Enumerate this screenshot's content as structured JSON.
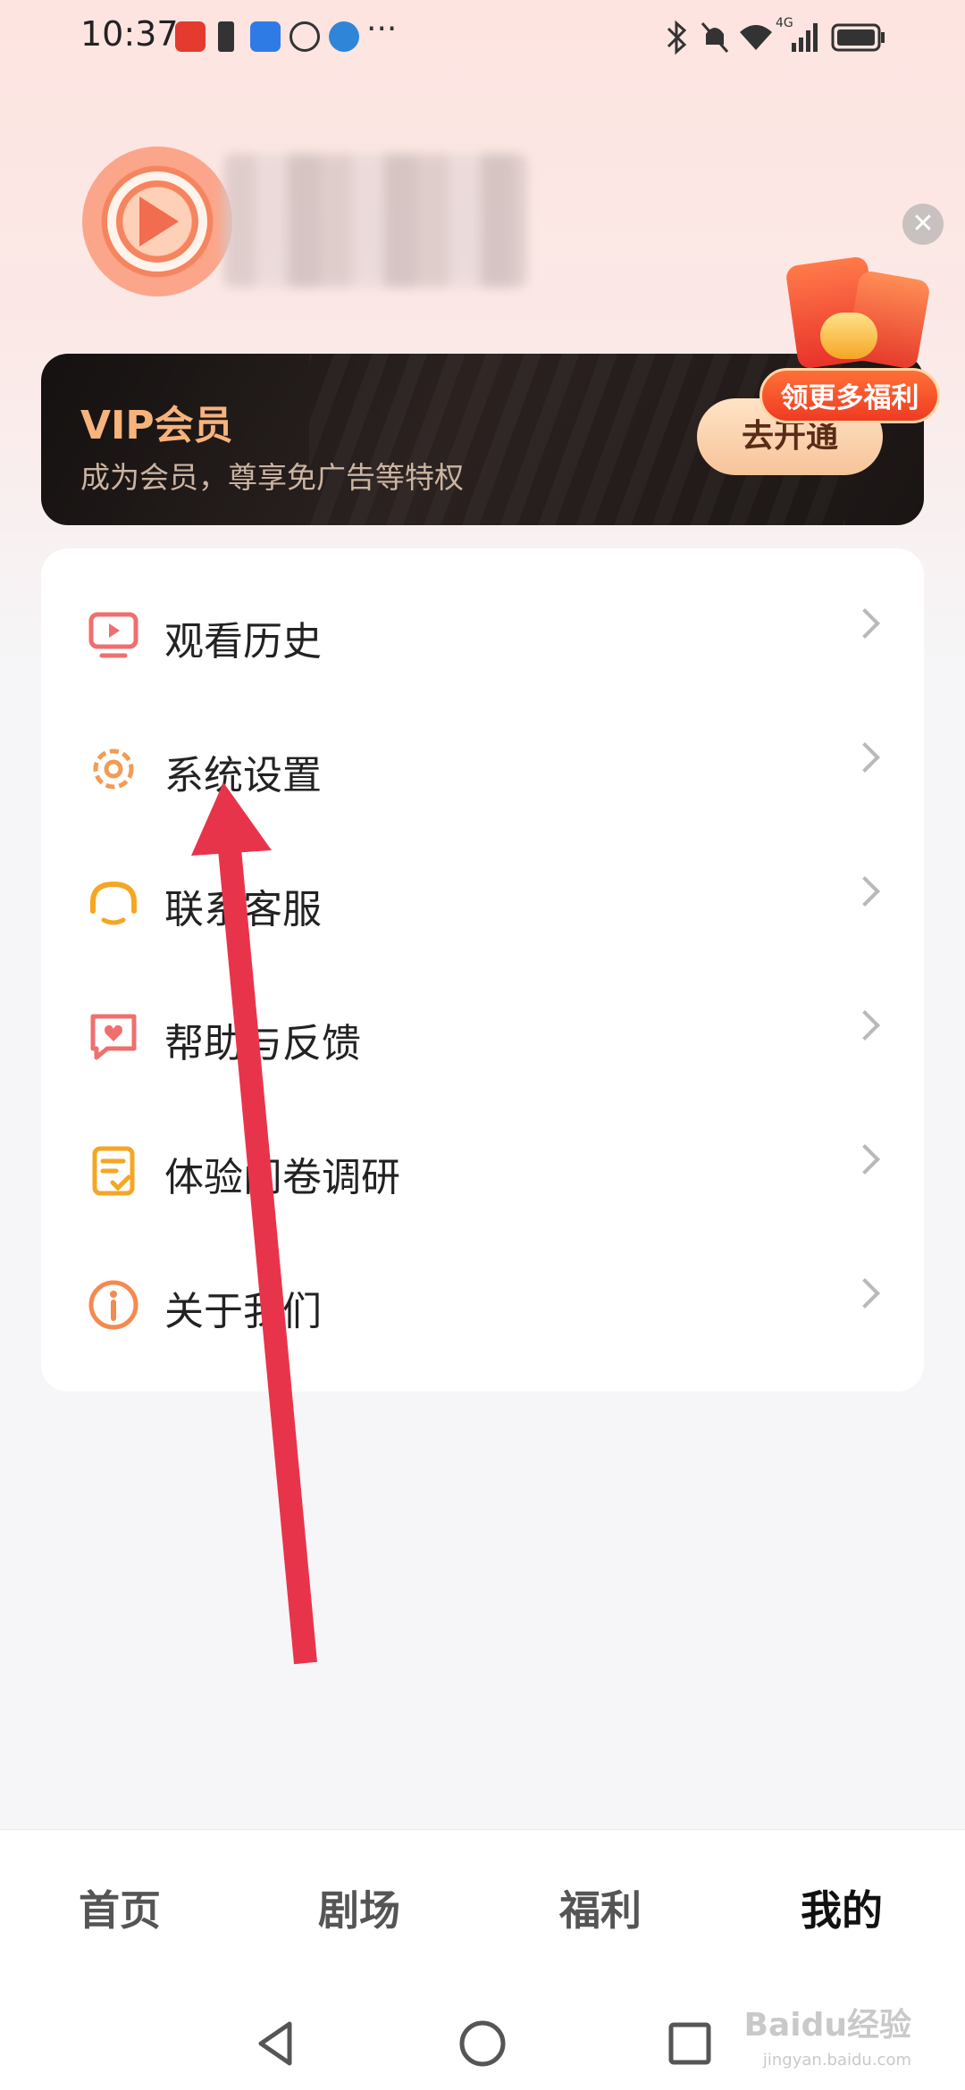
{
  "status_bar": {
    "time": "10:37",
    "left_icons": [
      "taobao-icon",
      "battery-alert-icon",
      "contacts-icon",
      "hand-icon",
      "browser-icon",
      "more-dots-icon"
    ],
    "right_icons": [
      "bluetooth-icon",
      "mute-bell-icon",
      "wifi-icon",
      "cellular-4g-icon",
      "battery-icon"
    ],
    "network_label": "4G",
    "more_label": "···"
  },
  "profile": {
    "avatar_icon": "play-logo-avatar",
    "close_icon": "close-icon"
  },
  "vip": {
    "title": "VIP会员",
    "subtitle": "成为会员，尊享免广告等特权",
    "button_label": "去开通",
    "promo_label": "领更多福利"
  },
  "menu": {
    "items": [
      {
        "label": "观看历史",
        "icon": "tv-icon"
      },
      {
        "label": "系统设置",
        "icon": "gear-icon"
      },
      {
        "label": "联系客服",
        "icon": "headset-icon"
      },
      {
        "label": "帮助与反馈",
        "icon": "heart-chat-icon"
      },
      {
        "label": "体验问卷调研",
        "icon": "survey-icon"
      },
      {
        "label": "关于我们",
        "icon": "info-icon"
      }
    ]
  },
  "bottom_nav": {
    "tabs": [
      {
        "label": "首页",
        "active": false
      },
      {
        "label": "剧场",
        "active": false
      },
      {
        "label": "福利",
        "active": false
      },
      {
        "label": "我的",
        "active": true
      }
    ]
  },
  "watermark": {
    "text": "Baidu经验",
    "sub": "jingyan.baidu.com"
  },
  "colors": {
    "accent_orange": "#f5894f",
    "vip_gold": "#f7b37c",
    "arrow_red": "#e8344a"
  }
}
